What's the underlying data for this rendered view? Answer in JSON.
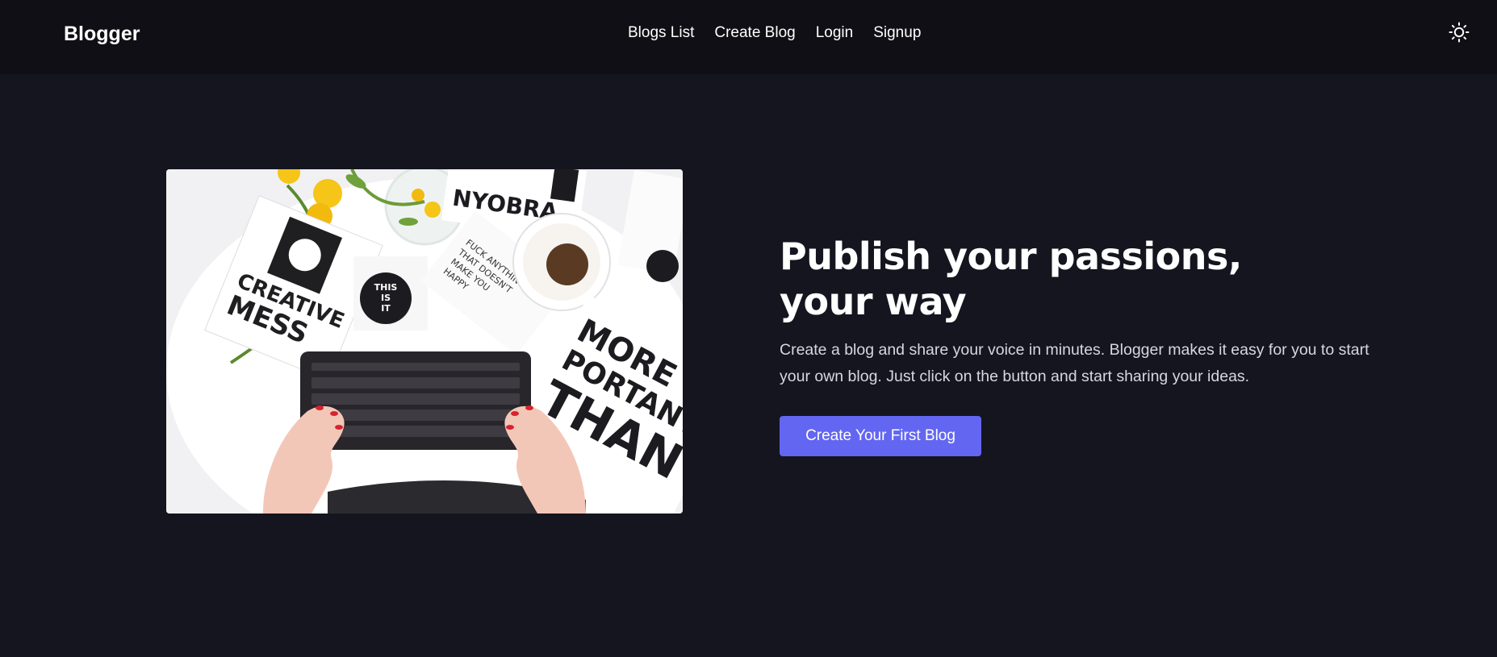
{
  "navbar": {
    "brand": "Blogger",
    "links": [
      "Blogs List",
      "Create Blog",
      "Login",
      "Signup"
    ],
    "theme_toggle_icon": "sun-icon"
  },
  "hero": {
    "headline_line1": "Publish your passions,",
    "headline_line2": "your way",
    "description": "Create a blog and share your voice in minutes. Blogger makes it easy for you to start your own blog. Just click on the button and start sharing your ideas.",
    "cta_label": "Create Your First Blog",
    "image": {
      "subject": "desk-with-keyboard-coffee-flowers-posters",
      "notebook_text": "CREATIVE MESS",
      "sticker_text": "THIS IS IT",
      "poster_text": "FUCK ANYTHING THAT DOESN'T MAKE YOU HAPPY",
      "poster2_text": "MORE IMPORTANT THAN",
      "poster3_text": "NYOBRA"
    }
  },
  "colors": {
    "background": "#15151f",
    "navbar": "#0f0f15",
    "accent": "#6366f1",
    "text": "#ffffff"
  }
}
